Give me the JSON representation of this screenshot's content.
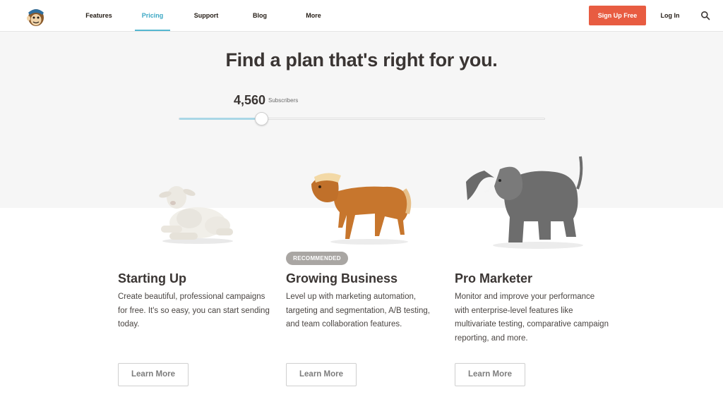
{
  "header": {
    "logo_name": "freddie-logo",
    "nav": [
      {
        "label": "Features"
      },
      {
        "label": "Pricing",
        "active": true
      },
      {
        "label": "Support"
      },
      {
        "label": "Blog"
      },
      {
        "label": "More"
      }
    ],
    "signup_label": "Sign Up Free",
    "login_label": "Log In",
    "search_icon": "search-icon"
  },
  "hero": {
    "headline": "Find a plan that's right for you.",
    "subscribers": {
      "count": "4,560",
      "label": "Subscribers",
      "slider_fraction": 0.225
    }
  },
  "plans": [
    {
      "title": "Starting Up",
      "description": "Create beautiful, professional campaigns for free. It's so easy, you can start sending today.",
      "cta": "Learn More",
      "animal": "lamb-figurine"
    },
    {
      "title": "Growing Business",
      "badge": "RECOMMENDED",
      "description": "Level up with marketing automation, targeting and segmentation, A/B testing, and team collaboration features.",
      "cta": "Learn More",
      "animal": "horse-figurine"
    },
    {
      "title": "Pro Marketer",
      "description": "Monitor and improve your performance with enterprise-level features like multivariate testing, comparative campaign reporting, and more.",
      "cta": "Learn More",
      "animal": "elephant-figurine"
    }
  ],
  "colors": {
    "accent_blue": "#55b7d0",
    "signup_red": "#e85c41",
    "hero_bg": "#f6f6f6",
    "badge_gray": "#a9a6a3"
  }
}
